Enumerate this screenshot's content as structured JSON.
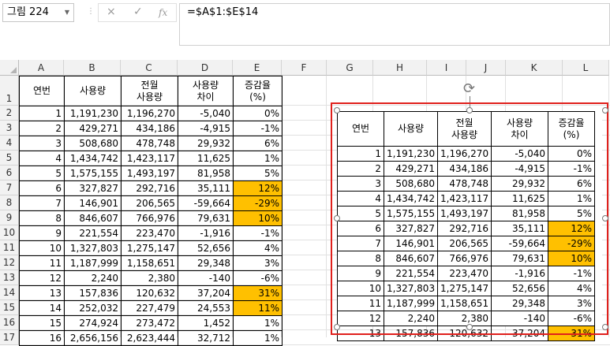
{
  "formula_bar": {
    "name_box": "그림 224",
    "cancel_icon": "×",
    "enter_icon": "✓",
    "function_icon": "fx",
    "formula": "=$A$1:$E$14"
  },
  "columns": [
    "A",
    "B",
    "C",
    "D",
    "E",
    "F",
    "G",
    "H",
    "I",
    "J",
    "K",
    "L"
  ],
  "rows": [
    "1",
    "2",
    "3",
    "4",
    "5",
    "6",
    "7",
    "8",
    "9",
    "10",
    "11",
    "12",
    "13",
    "14",
    "15",
    "16",
    "17"
  ],
  "left_table": {
    "headers": [
      "연번",
      "사용량",
      "전월\n사용량",
      "사용량\n차이",
      "증감율\n(%)"
    ],
    "rows": [
      {
        "cells": [
          "1",
          "1,191,230",
          "1,196,270",
          "-5,040",
          "0%"
        ],
        "hl": false
      },
      {
        "cells": [
          "2",
          "429,271",
          "434,186",
          "-4,915",
          "-1%"
        ],
        "hl": false
      },
      {
        "cells": [
          "3",
          "508,680",
          "478,748",
          "29,932",
          "6%"
        ],
        "hl": false
      },
      {
        "cells": [
          "4",
          "1,434,742",
          "1,423,117",
          "11,625",
          "1%"
        ],
        "hl": false
      },
      {
        "cells": [
          "5",
          "1,575,155",
          "1,493,197",
          "81,958",
          "5%"
        ],
        "hl": false
      },
      {
        "cells": [
          "6",
          "327,827",
          "292,716",
          "35,111",
          "12%"
        ],
        "hl": true
      },
      {
        "cells": [
          "7",
          "146,901",
          "206,565",
          "-59,664",
          "-29%"
        ],
        "hl": true
      },
      {
        "cells": [
          "8",
          "846,607",
          "766,976",
          "79,631",
          "10%"
        ],
        "hl": true
      },
      {
        "cells": [
          "9",
          "221,554",
          "223,470",
          "-1,916",
          "-1%"
        ],
        "hl": false
      },
      {
        "cells": [
          "10",
          "1,327,803",
          "1,275,147",
          "52,656",
          "4%"
        ],
        "hl": false
      },
      {
        "cells": [
          "11",
          "1,187,999",
          "1,158,651",
          "29,348",
          "3%"
        ],
        "hl": false
      },
      {
        "cells": [
          "12",
          "2,240",
          "2,380",
          "-140",
          "-6%"
        ],
        "hl": false
      },
      {
        "cells": [
          "13",
          "157,836",
          "120,632",
          "37,204",
          "31%"
        ],
        "hl": true
      },
      {
        "cells": [
          "14",
          "252,032",
          "227,479",
          "24,553",
          "11%"
        ],
        "hl": true
      },
      {
        "cells": [
          "15",
          "274,924",
          "273,472",
          "1,452",
          "1%"
        ],
        "hl": false
      },
      {
        "cells": [
          "16",
          "2,656,156",
          "2,623,444",
          "32,712",
          "1%"
        ],
        "hl": false
      }
    ]
  },
  "picture_table": {
    "headers": [
      "연번",
      "사용량",
      "전월\n사용량",
      "사용량\n차이",
      "증감율\n(%)"
    ],
    "rows": [
      {
        "cells": [
          "1",
          "1,191,230",
          "1,196,270",
          "-5,040",
          "0%"
        ],
        "hl": false
      },
      {
        "cells": [
          "2",
          "429,271",
          "434,186",
          "-4,915",
          "-1%"
        ],
        "hl": false
      },
      {
        "cells": [
          "3",
          "508,680",
          "478,748",
          "29,932",
          "6%"
        ],
        "hl": false
      },
      {
        "cells": [
          "4",
          "1,434,742",
          "1,423,117",
          "11,625",
          "1%"
        ],
        "hl": false
      },
      {
        "cells": [
          "5",
          "1,575,155",
          "1,493,197",
          "81,958",
          "5%"
        ],
        "hl": false
      },
      {
        "cells": [
          "6",
          "327,827",
          "292,716",
          "35,111",
          "12%"
        ],
        "hl": true
      },
      {
        "cells": [
          "7",
          "146,901",
          "206,565",
          "-59,664",
          "-29%"
        ],
        "hl": true
      },
      {
        "cells": [
          "8",
          "846,607",
          "766,976",
          "79,631",
          "10%"
        ],
        "hl": true
      },
      {
        "cells": [
          "9",
          "221,554",
          "223,470",
          "-1,916",
          "-1%"
        ],
        "hl": false
      },
      {
        "cells": [
          "10",
          "1,327,803",
          "1,275,147",
          "52,656",
          "4%"
        ],
        "hl": false
      },
      {
        "cells": [
          "11",
          "1,187,999",
          "1,158,651",
          "29,348",
          "3%"
        ],
        "hl": false
      },
      {
        "cells": [
          "12",
          "2,240",
          "2,380",
          "-140",
          "-6%"
        ],
        "hl": false
      },
      {
        "cells": [
          "13",
          "157,836",
          "120,632",
          "37,204",
          "31%"
        ],
        "hl": true
      }
    ]
  },
  "colors": {
    "highlight": "#ffc000",
    "selection_border": "#e0201c"
  }
}
